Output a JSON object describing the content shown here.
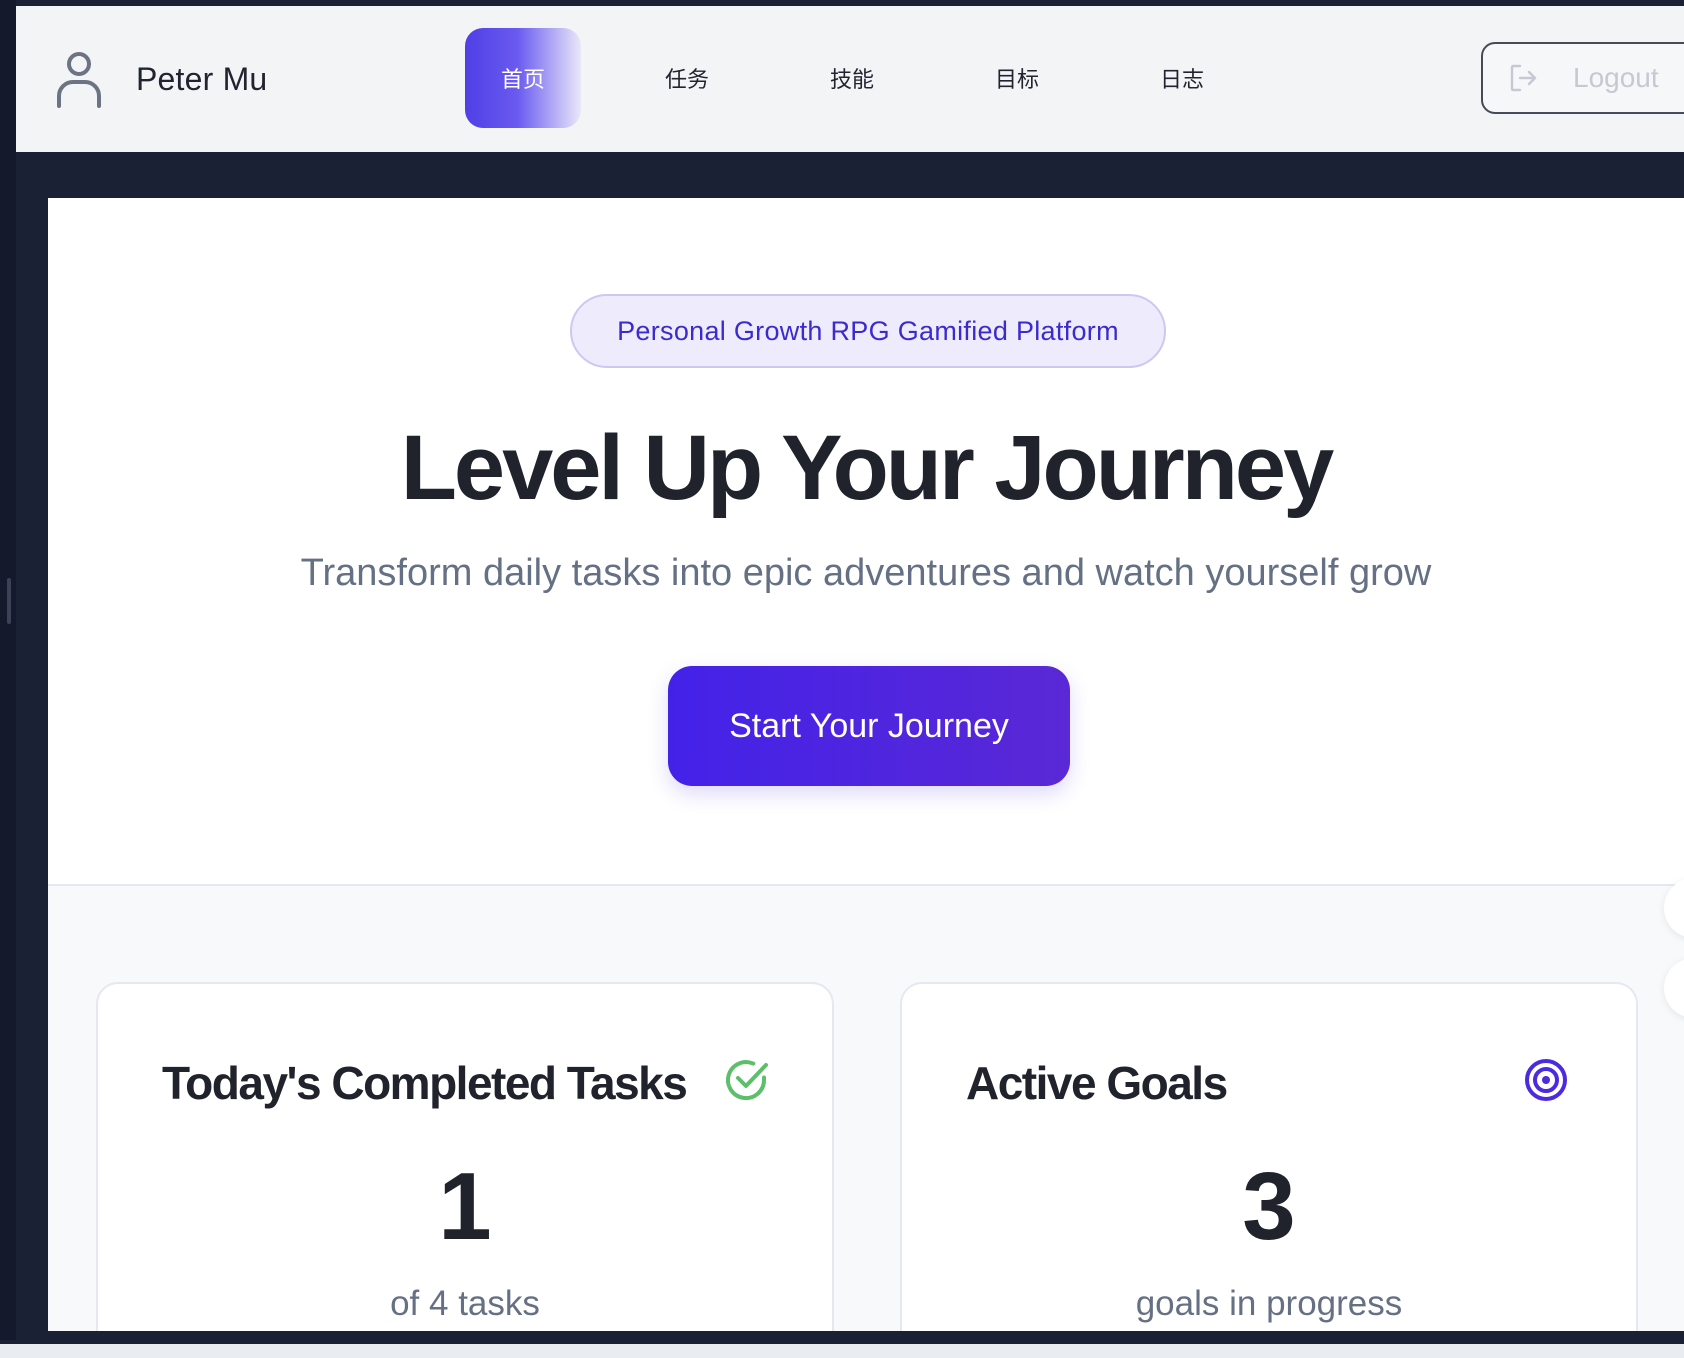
{
  "user": {
    "name": "Peter Mu",
    "icon": "user-icon"
  },
  "nav": {
    "items": [
      {
        "label": "首页",
        "active": true
      },
      {
        "label": "任务",
        "active": false
      },
      {
        "label": "技能",
        "active": false
      },
      {
        "label": "目标",
        "active": false
      },
      {
        "label": "日志",
        "active": false
      }
    ],
    "logout": {
      "label": "Logout",
      "icon": "logout-icon"
    }
  },
  "hero": {
    "badge": "Personal Growth RPG Gamified Platform",
    "title": "Level Up Your Journey",
    "subtitle": "Transform daily tasks into epic adventures and watch yourself grow",
    "cta": "Start Your Journey"
  },
  "stats": [
    {
      "title": "Today's Completed Tasks",
      "value": "1",
      "caption": "of 4 tasks",
      "icon": "check-circle-icon",
      "icon_color": "#5cbf6a"
    },
    {
      "title": "Active Goals",
      "value": "3",
      "caption": "goals in progress",
      "icon": "target-icon",
      "icon_color": "#4b2be0"
    }
  ],
  "colors": {
    "accent": "#4322e8",
    "text_primary": "#20232c",
    "text_muted": "#667085",
    "badge_bg": "#eeebfd"
  }
}
